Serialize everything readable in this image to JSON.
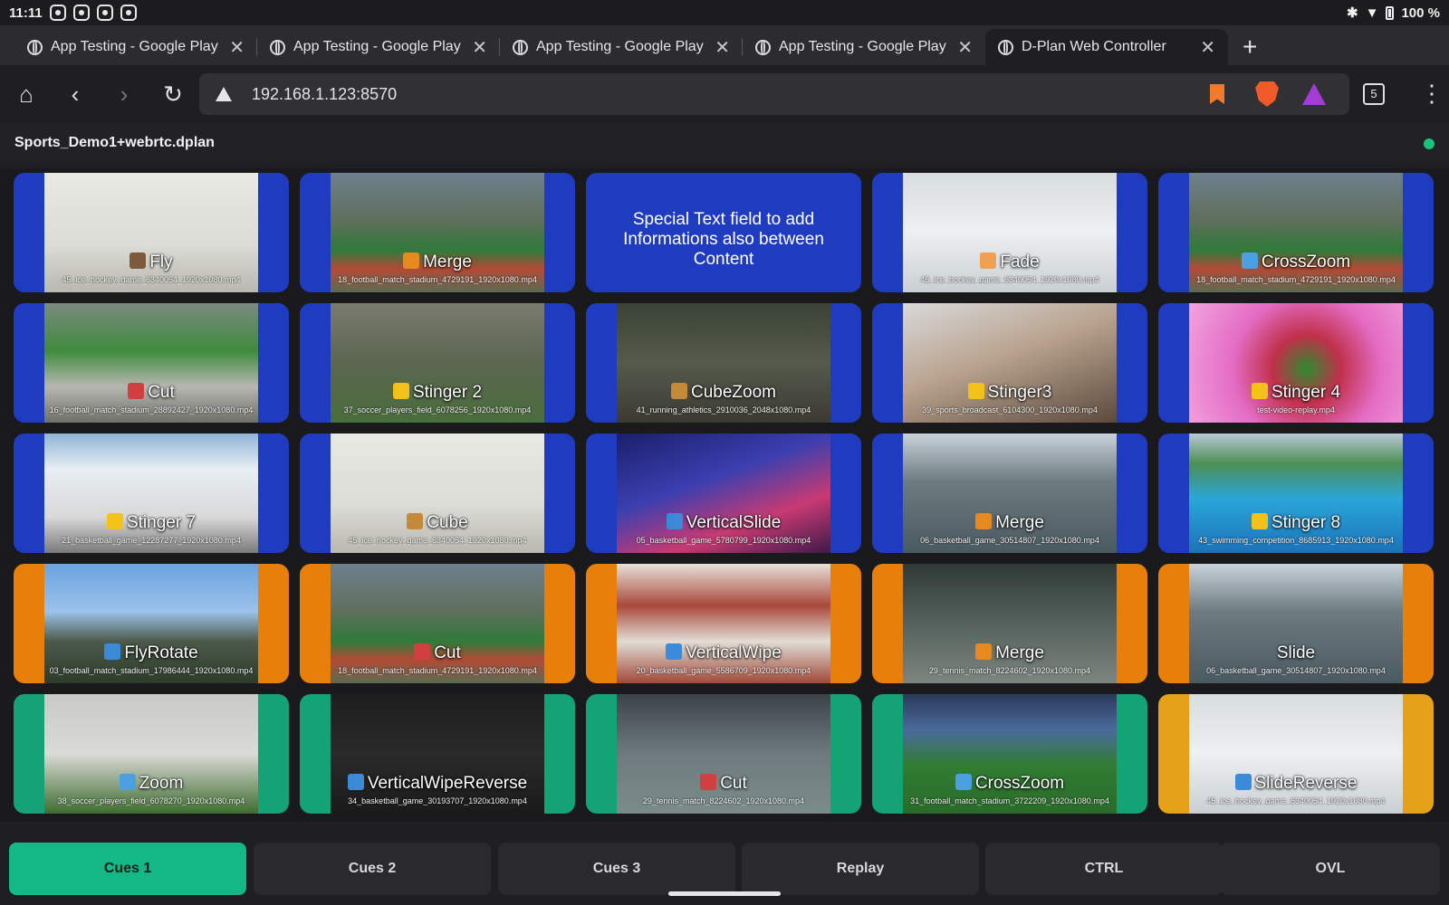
{
  "statusbar": {
    "time": "11:11",
    "battery": "100 %"
  },
  "tabs": [
    {
      "title": "App Testing - Google Play"
    },
    {
      "title": "App Testing - Google Play"
    },
    {
      "title": "App Testing - Google Play"
    },
    {
      "title": "App Testing - Google Play"
    },
    {
      "title": "D-Plan Web Controller"
    }
  ],
  "toolbar": {
    "url": "192.168.1.123:8570",
    "tab_count": "5"
  },
  "app": {
    "project_name": "Sports_Demo1+webrtc.dplan"
  },
  "colors": {
    "blue": "#1f3bbf",
    "orange": "#e77f0a",
    "green": "#14a374",
    "gold": "#e5a118",
    "active_nav": "#13b886"
  },
  "cues": [
    {
      "label": "Fly",
      "file": "45_ice_hockey_game_6340054_1920x1080.mp4",
      "icon": "bird-icon",
      "color": "blue"
    },
    {
      "label": "Merge",
      "file": "18_football_match_stadium_4729191_1920x1080.mp4",
      "icon": "merge-icon",
      "color": "blue"
    },
    {
      "text": "Special Text field to add Informations also between Content",
      "color": "blue"
    },
    {
      "label": "Fade",
      "file": "45_ice_hockey_game_6340054_1920x1080.mp4",
      "icon": "sunrise-icon",
      "color": "blue"
    },
    {
      "label": "CrossZoom",
      "file": "18_football_match_stadium_4729191_1920x1080.mp4",
      "icon": "magnifier-icon",
      "color": "blue"
    },
    {
      "label": "Cut",
      "file": "16_football_match_stadium_28892427_1920x1080.mp4",
      "icon": "scissors-icon",
      "color": "blue"
    },
    {
      "label": "Stinger 2",
      "file": "37_soccer_players_field_6078256_1920x1080.mp4",
      "icon": "star-icon",
      "color": "blue"
    },
    {
      "label": "CubeZoom",
      "file": "41_running_athletics_2910036_2048x1080.mp4",
      "icon": "box-icon",
      "color": "blue"
    },
    {
      "label": "Stinger3",
      "file": "39_sports_broadcast_6104300_1920x1080.mp4",
      "icon": "star-icon",
      "color": "blue"
    },
    {
      "label": "Stinger 4",
      "file": "test-video-replay.mp4",
      "icon": "star-icon",
      "color": "blue"
    },
    {
      "label": "Stinger 7",
      "file": "21_basketball_game_12287277_1920x1080.mp4",
      "icon": "star-icon",
      "color": "blue"
    },
    {
      "label": "Cube",
      "file": "45_ice_hockey_game_6340054_1920x1080.mp4",
      "icon": "box-icon",
      "color": "blue"
    },
    {
      "label": "VerticalSlide",
      "file": "05_basketball_game_5780799_1920x1080.mp4",
      "icon": "down-arrow-icon",
      "color": "blue"
    },
    {
      "label": "Merge",
      "file": "06_basketball_game_30514807_1920x1080.mp4",
      "icon": "merge-icon",
      "color": "blue"
    },
    {
      "label": "Stinger 8",
      "file": "43_swimming_competition_8685913_1920x1080.mp4",
      "icon": "star-icon",
      "color": "blue"
    },
    {
      "label": "FlyRotate",
      "file": "03_football_match_stadium_17986444_1920x1080.mp4",
      "icon": "rotate-icon",
      "color": "orange"
    },
    {
      "label": "Cut",
      "file": "18_football_match_stadium_4729191_1920x1080.mp4",
      "icon": "scissors-icon",
      "color": "orange"
    },
    {
      "label": "VerticalWipe",
      "file": "20_basketball_game_5586709_1920x1080.mp4",
      "icon": "down-arrow-icon",
      "color": "orange"
    },
    {
      "label": "Merge",
      "file": "29_tennis_match_8224602_1920x1080.mp4",
      "icon": "merge-icon",
      "color": "orange"
    },
    {
      "label": "Slide",
      "file": "06_basketball_game_30514807_1920x1080.mp4",
      "icon": "",
      "color": "orange"
    },
    {
      "label": "Zoom",
      "file": "38_soccer_players_field_6078270_1920x1080.mp4",
      "icon": "magnifier-icon",
      "color": "green"
    },
    {
      "label": "VerticalWipeReverse",
      "file": "34_basketball_game_30193707_1920x1080.mp4",
      "icon": "up-arrow-icon",
      "color": "green"
    },
    {
      "label": "Cut",
      "file": "29_tennis_match_8224602_1920x1080.mp4",
      "icon": "scissors-icon",
      "color": "green"
    },
    {
      "label": "CrossZoom",
      "file": "31_football_match_stadium_3722209_1920x1080.mp4",
      "icon": "magnifier-icon",
      "color": "green"
    },
    {
      "label": "SlideReverse",
      "file": "45_ice_hockey_game_6340054_1920x1080.mp4",
      "icon": "left-arrow-icon",
      "color": "gold"
    }
  ],
  "nav": [
    {
      "label": "Cues 1",
      "active": true
    },
    {
      "label": "Cues 2"
    },
    {
      "label": "Cues 3"
    },
    {
      "label": "Replay"
    },
    {
      "label": "CTRL"
    },
    {
      "label": "OVL"
    }
  ]
}
